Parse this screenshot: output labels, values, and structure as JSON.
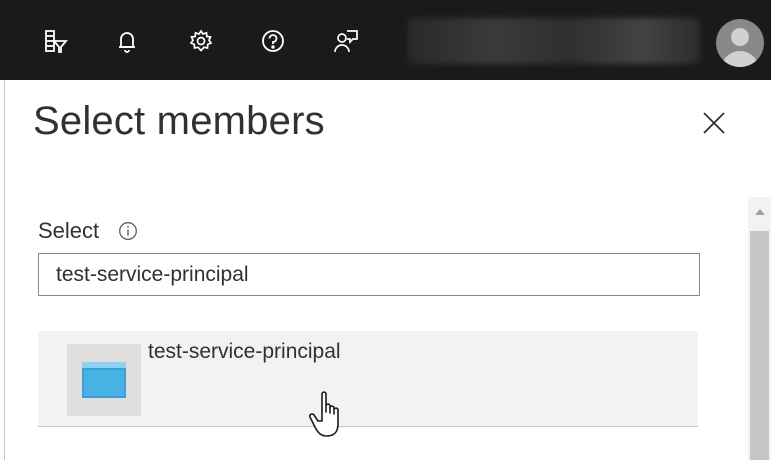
{
  "topbar": {
    "icons": [
      "directory-filter-icon",
      "bell-icon",
      "gear-icon",
      "help-icon",
      "feedback-icon"
    ],
    "avatar_icon": "user-avatar-icon"
  },
  "panel": {
    "title": "Select members",
    "close_icon": "close-icon"
  },
  "select": {
    "label": "Select",
    "info_icon": "info-icon",
    "value": "test-service-principal"
  },
  "results": [
    {
      "name": "test-service-principal",
      "icon": "application-icon"
    }
  ],
  "colors": {
    "topbar_bg": "#1b1a19",
    "result_bg": "#f3f2f1",
    "app_icon": "#3aa0d8"
  }
}
